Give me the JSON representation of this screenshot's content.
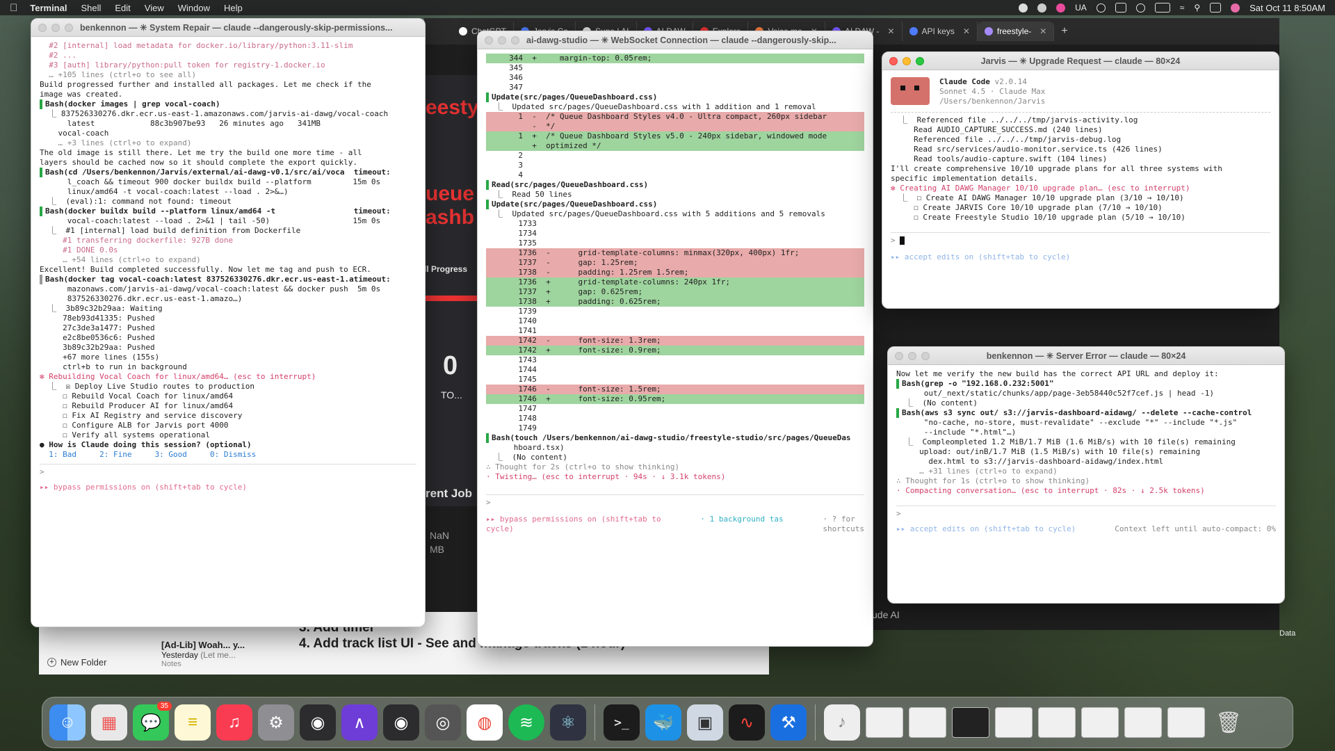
{
  "menubar": {
    "app": "Terminal",
    "items": [
      "Shell",
      "Edit",
      "View",
      "Window",
      "Help"
    ],
    "locale": "UA",
    "datetime": "Sat Oct 11  8:50AM"
  },
  "browser": {
    "tabs": [
      "ChatGPT",
      "Jarvis Co",
      "Suno | AI",
      "AI DAW",
      "Explore",
      "Voice me",
      "AI DAW -",
      "API keys",
      "freestyle-"
    ],
    "bg_heading_1": "eesty",
    "bg_heading_2": "ueue",
    "bg_heading_3": "ashb",
    "bg_progress": "ll Progress",
    "bg_zero": "0",
    "bg_to": "TO...",
    "bg_current_job": "rent Job",
    "bg_nan": "NaN",
    "bg_mb": "MB",
    "bg_claude": "ude AI",
    "bg_data": "Data"
  },
  "notes": {
    "new_folder": "New Folder",
    "item_title": "[Ad-Lib] Woah... y...",
    "item_date": "Yesterday",
    "item_preview": "(Let me...",
    "item_folder": "Notes",
    "line1": "3. Add timel",
    "line2": "4. Add track list UI - See and manage tracks (1 hour)"
  },
  "win1": {
    "title": "benkennon — ✳ System Repair — claude --dangerously-skip-permissions...",
    "lines": [
      "  #2 [internal] load metadata for docker.io/library/python:3.11-slim",
      "  #2 ...",
      "",
      "  #3 [auth] library/python:pull token for registry-1.docker.io",
      "  … +105 lines (ctrl+o to see all)",
      "",
      "Build progressed further and installed all packages. Let me check if the",
      "image was created.",
      "",
      "Bash(docker images | grep vocal-coach)",
      "  ⎿ 837526330276.dkr.ecr.us-east-1.amazonaws.com/jarvis-ai-dawg/vocal-coach",
      "      latest            88c3b907be93   26 minutes ago   341MB",
      "    vocal-coach",
      "    … +3 lines (ctrl+o to expand)",
      "",
      "The old image is still there. Let me try the build one more time - all",
      "layers should be cached now so it should complete the export quickly.",
      "",
      "Bash(cd /Users/benkennon/Jarvis/external/ai-dawg-v0.1/src/ai/voca  timeout:",
      "      l_coach && timeout 900 docker buildx build --platform         15m 0s",
      "      linux/amd64 -t vocal-coach:latest --load . 2>&…)",
      "  ⎿  (eval):1: command not found: timeout",
      "",
      "Bash(docker buildx build --platform linux/amd64 -t                 timeout:",
      "      vocal-coach:latest --load . 2>&1 | tail -50)                  15m 0s",
      "  ⎿  #1 [internal] load build definition from Dockerfile",
      "     #1 transferring dockerfile: 927B done",
      "     #1 DONE 0.0s",
      "     … +54 lines (ctrl+o to expand)",
      "",
      "Excellent! Build completed successfully. Now let me tag and push to ECR.",
      "",
      "Bash(docker tag vocal-coach:latest 837526330276.dkr.ecr.us-east-1.atimeout:",
      "      mazonaws.com/jarvis-ai-dawg/vocal-coach:latest && docker push  5m 0s",
      "      837526330276.dkr.ecr.us-east-1.amazo…)",
      "  ⎿  3b89c32b29aa: Waiting",
      "     78eb93d41335: Pushed",
      "     27c3de3a1477: Pushed",
      "     e2c8be0536c6: Pushed",
      "     3b89c32b29aa: Pushed",
      "     +67 more lines (155s)",
      "     ctrl+b to run in background",
      "",
      "✻ Rebuilding Vocal Coach for linux/amd64… (esc to interrupt)",
      "  ⎿  ☒ Deploy Live Studio routes to production",
      "     ☐ Rebuild Vocal Coach for linux/amd64",
      "     ☐ Rebuild Producer AI for linux/amd64",
      "     ☐ Fix AI Registry and service discovery",
      "     ☐ Configure ALB for Jarvis port 4000",
      "     ☐ Verify all systems operational",
      "",
      "● How is Claude doing this session? (optional)",
      "  1: Bad     2: Fine     3: Good     0: Dismiss"
    ],
    "prompt": ">",
    "footer": "▸▸ bypass permissions on (shift+tab to cycle)"
  },
  "win2": {
    "title": "ai-dawg-studio — ✳ WebSocket Connection — claude --dangerously-skip...",
    "lines": [
      "     344  +     margin-top: 0.05rem;",
      "     345",
      "     346",
      "     347",
      "",
      "Update(src/pages/QueueDashboard.css)",
      "  ⎿  Updated src/pages/QueueDashboard.css with 1 addition and 1 removal",
      "       1  -  /* Queue Dashboard Styles v4.0 - Ultra compact, 260px sidebar",
      "          -  */",
      "       1  +  /* Queue Dashboard Styles v5.0 - 240px sidebar, windowed mode",
      "          +  optimized */",
      "       2",
      "       3",
      "       4",
      "",
      "Read(src/pages/QueueDashboard.css)",
      "  ⎿  Read 50 lines",
      "",
      "Update(src/pages/QueueDashboard.css)",
      "  ⎿  Updated src/pages/QueueDashboard.css with 5 additions and 5 removals",
      "       1733",
      "       1734",
      "       1735",
      "       1736  -      grid-template-columns: minmax(320px, 400px) 1fr;",
      "       1737  -      gap: 1.25rem;",
      "       1738  -      padding: 1.25rem 1.5rem;",
      "       1736  +      grid-template-columns: 240px 1fr;",
      "       1737  +      gap: 0.625rem;",
      "       1738  +      padding: 0.625rem;",
      "       1739",
      "       1740",
      "       1741",
      "       1742  -      font-size: 1.3rem;",
      "       1742  +      font-size: 0.9rem;",
      "       1743",
      "       1744",
      "       1745",
      "       1746  -      font-size: 1.5rem;",
      "       1746  +      font-size: 0.95rem;",
      "       1747",
      "       1748",
      "       1749",
      "",
      "Bash(touch /Users/benkennon/ai-dawg-studio/freestyle-studio/src/pages/QueueDas",
      "      hboard.tsx)",
      "  ⎿  (No content)",
      "",
      "∴ Thought for 2s (ctrl+o to show thinking)",
      "",
      "· Twisting… (esc to interrupt · 94s · ↓ 3.1k tokens)"
    ],
    "prompt": ">",
    "footer_left": "▸▸ bypass permissions on (shift+tab to",
    "footer_left2": "cycle)",
    "footer_mid": "· 1 background tas",
    "footer_right": "· ? for",
    "footer_right2": "shortcuts"
  },
  "win3": {
    "title": "Jarvis — ✳ Upgrade Request — claude — 80×24",
    "product": "Claude Code",
    "version": "v2.0.14",
    "model": "Sonnet 4.5 · Claude Max",
    "path": "/Users/benkennon/Jarvis",
    "lines": [
      "  ⎿  Referenced file ../../../tmp/jarvis-activity.log",
      "     Read AUDIO_CAPTURE_SUCCESS.md (240 lines)",
      "     Referenced file ../../../tmp/jarvis-debug.log",
      "     Read src/services/audio-monitor.service.ts (426 lines)",
      "     Read tools/audio-capture.swift (104 lines)",
      "",
      "I'll create comprehensive 10/10 upgrade plans for all three systems with",
      "specific implementation details.",
      "",
      "✻ Creating AI DAWG Manager 10/10 upgrade plan… (esc to interrupt)",
      "  ⎿  ☐ Create AI DAWG Manager 10/10 upgrade plan (3/10 → 10/10)",
      "     ☐ Create JARVIS Core 10/10 upgrade plan (7/10 → 10/10)",
      "     ☐ Create Freestyle Studio 10/10 upgrade plan (5/10 → 10/10)"
    ],
    "prompt": "> ",
    "footer": "▸▸ accept edits on (shift+tab to cycle)"
  },
  "win4": {
    "title": "benkennon — ✳ Server Error — claude — 80×24",
    "lines": [
      "Now let me verify the new build has the correct API URL and deploy it:",
      "",
      "Bash(grep -o \"192.168.0.232:5001\"",
      "      out/_next/static/chunks/app/page-3eb58440c52f7cef.js | head -1)",
      "  ⎿  (No content)",
      "",
      "Bash(aws s3 sync out/ s3://jarvis-dashboard-aidawg/ --delete --cache-control",
      "      \"no-cache, no-store, must-revalidate\" --exclude \"*\" --include \"*.js\"",
      "      --include \"*.html\"…)",
      "  ⎿  Compleompleted 1.2 MiB/1.7 MiB (1.6 MiB/s) with 10 file(s) remaining",
      "     upload: out/inB/1.7 MiB (1.5 MiB/s) with 10 file(s) remaining",
      "       dex.html to s3://jarvis-dashboard-aidawg/index.html",
      "     … +31 lines (ctrl+o to expand)",
      "",
      "∴ Thought for 1s (ctrl+o to show thinking)",
      "",
      "· Compacting conversation… (esc to interrupt · 82s · ↓ 2.5k tokens)"
    ],
    "prompt": ">",
    "footer_left": "▸▸ accept edits on (shift+tab to cycle)",
    "footer_right": "Context left until auto-compact: 0%"
  },
  "dock": {
    "messages_badge": "35",
    "apps": [
      "finder-icon",
      "launchpad-icon",
      "messages-icon",
      "notes-icon",
      "music-icon",
      "system-settings-icon",
      "logic-icon",
      "arc-icon",
      "logic2-icon",
      "compressor-icon",
      "chrome-icon",
      "spotify-icon",
      "electron-icon",
      "terminal-icon",
      "docker-icon",
      "preview-icon",
      "voice-memos-icon",
      "xcode-icon"
    ]
  },
  "colors": {
    "menubar": "#1e1e1e",
    "pink": "#d33f6a",
    "green": "#28a745",
    "diff_add": "#7fc57f",
    "diff_del": "#e3a3a3"
  }
}
